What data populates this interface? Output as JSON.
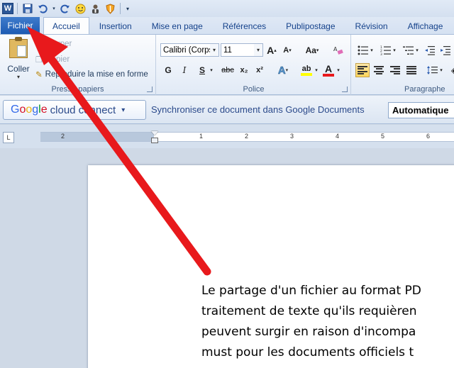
{
  "app": {
    "logo_letter": "W",
    "accent_color": "#2b5797"
  },
  "quick_access": {
    "icons": [
      "save-icon",
      "undo-icon",
      "redo-icon",
      "smiley-icon",
      "user-icon",
      "shield-icon",
      "customize-dropdown-icon"
    ]
  },
  "tabs": [
    {
      "label": "Fichier"
    },
    {
      "label": "Accueil"
    },
    {
      "label": "Insertion"
    },
    {
      "label": "Mise en page"
    },
    {
      "label": "Références"
    },
    {
      "label": "Publipostage"
    },
    {
      "label": "Révision"
    },
    {
      "label": "Affichage"
    }
  ],
  "ribbon": {
    "clipboard": {
      "group_label": "Presse-papiers",
      "paste_label": "Coller",
      "cut_label": "Couper",
      "copy_label": "Copier",
      "format_painter_label": "Reproduire la mise en forme"
    },
    "font": {
      "group_label": "Police",
      "font_name": "Calibri (Corps",
      "font_size": "11",
      "bold": "G",
      "italic": "I",
      "underline": "S",
      "strikethrough": "abc",
      "subscript": "x₂",
      "superscript": "x²",
      "grow": "A",
      "shrink": "A",
      "change_case": "Aa",
      "text_effects": "A",
      "highlight": "ab",
      "font_color": "A"
    },
    "paragraph": {
      "group_label": "Paragraphe"
    }
  },
  "google_bar": {
    "logo_g1": "G",
    "logo_o1": "o",
    "logo_o2": "o",
    "logo_g2": "g",
    "logo_l": "l",
    "logo_e": "e",
    "brand_rest": "cloud connect",
    "dropdown": "▾",
    "sync_text": "Synchroniser ce document dans Google Documents",
    "mode_value": "Automatique"
  },
  "ruler": {
    "corner_label": "L",
    "numbers": [
      "2",
      "1",
      "1",
      "2",
      "3",
      "4",
      "5",
      "6"
    ]
  },
  "document": {
    "lines": [
      "Le partage d'un fichier au format PD",
      "traitement de texte qu'ils requièren",
      "peuvent surgir en raison d'incompa",
      "must pour les documents officiels t"
    ]
  },
  "annotation": {
    "arrow_color": "#e8191c"
  }
}
